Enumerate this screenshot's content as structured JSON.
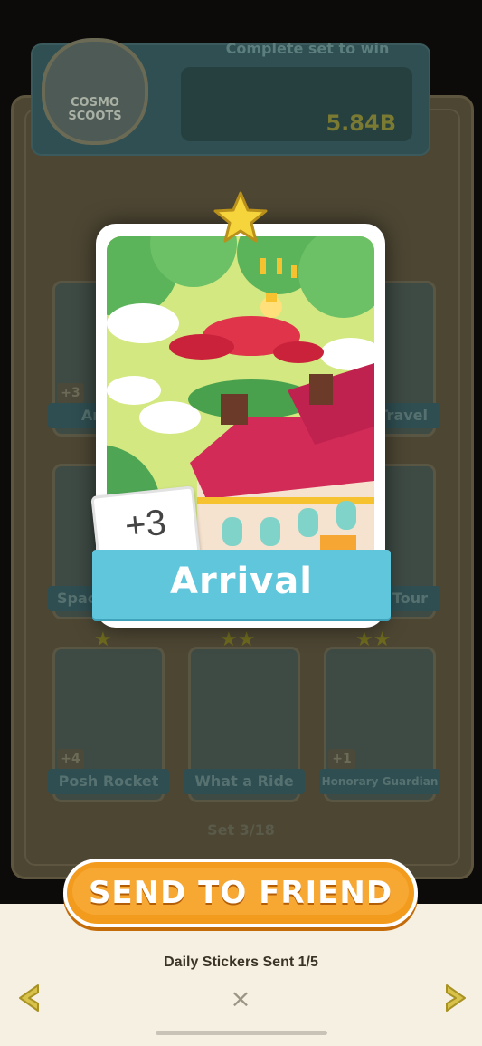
{
  "album": {
    "set_name": "COSMO SCOOTS",
    "subtitle": "Complete set to win",
    "reward_amount": "5.84B",
    "set_progress": "Set 3/18",
    "cards": [
      {
        "label": "Arrival",
        "count": "+3"
      },
      {
        "label": "Travel",
        "count": ""
      },
      {
        "label": "Spaceship",
        "count": ""
      },
      {
        "label": "Tour",
        "count": ""
      },
      {
        "label": "Posh Rocket",
        "count": "+4"
      },
      {
        "label": "What a Ride",
        "count": ""
      },
      {
        "label": "Honorary Guardian",
        "count": "+1"
      }
    ]
  },
  "sticker": {
    "name": "Arrival",
    "count": "+3",
    "stars": 1
  },
  "actions": {
    "send_label": "SEND TO FRIEND",
    "daily_sent": "Daily Stickers Sent 1/5",
    "close_symbol": "×",
    "prev_icon": "chevron-left-icon",
    "next_icon": "chevron-right-icon"
  },
  "colors": {
    "card_ribbon": "#5fc6dc",
    "send_button": "#f29b1d",
    "panel_bg": "#f5f0e1",
    "arrow": "#d8c24a",
    "star": "#f6d43c"
  }
}
